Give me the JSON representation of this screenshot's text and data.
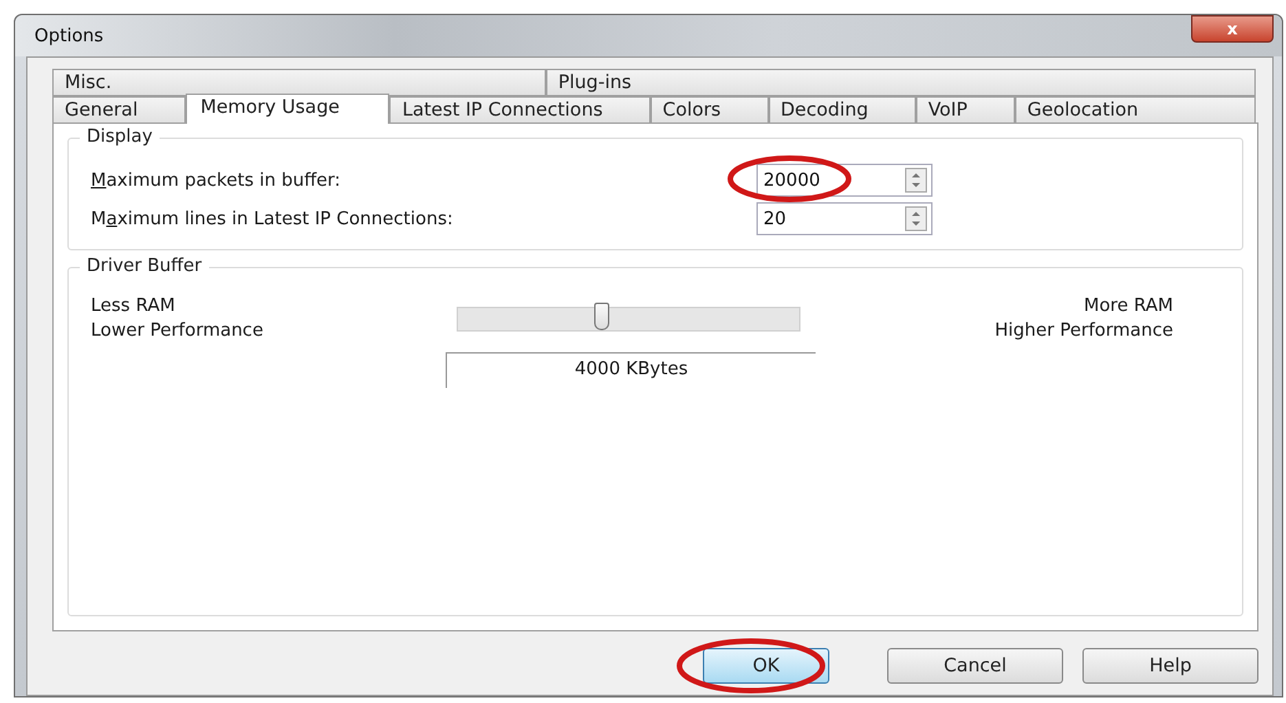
{
  "window": {
    "title": "Options",
    "close_label": "x"
  },
  "tab_rows": [
    [
      {
        "label": "Misc.",
        "selected": false
      },
      {
        "label": "Plug-ins",
        "selected": false
      }
    ],
    [
      {
        "label": "General",
        "selected": false
      },
      {
        "label": "Memory Usage",
        "selected": true
      },
      {
        "label": "Latest IP Connections",
        "selected": false
      },
      {
        "label": "Colors",
        "selected": false
      },
      {
        "label": "Decoding",
        "selected": false
      },
      {
        "label": "VoIP",
        "selected": false
      },
      {
        "label": "Geolocation",
        "selected": false
      }
    ]
  ],
  "display": {
    "title": "Display",
    "fields": [
      {
        "label": {
          "access_key": "M",
          "rest": "aximum packets in buffer:"
        },
        "value": "20000",
        "annotated": true
      },
      {
        "label": {
          "lead": "M",
          "access_key": "a",
          "rest": "ximum lines in Latest IP Connections:"
        },
        "value": "20",
        "annotated": false
      }
    ]
  },
  "driver_buffer": {
    "title": "Driver Buffer",
    "left_labels": [
      "Less RAM",
      "Lower Performance"
    ],
    "right_labels": [
      "More RAM",
      "Higher Performance"
    ],
    "level": 0.42,
    "reading": "4000 KBytes"
  },
  "buttons": [
    {
      "label": "OK",
      "default": true,
      "annotated": true
    },
    {
      "label": "Cancel",
      "default": false,
      "annotated": false
    },
    {
      "label": "Help",
      "default": false,
      "annotated": false
    }
  ]
}
